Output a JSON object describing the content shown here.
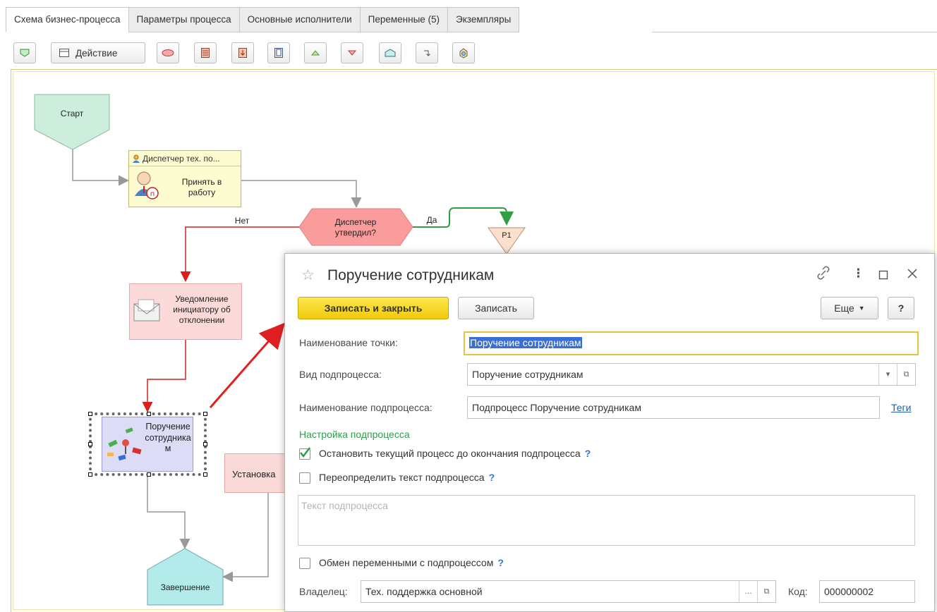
{
  "tabs": [
    {
      "label": "Схема бизнес-процесса",
      "active": true
    },
    {
      "label": "Параметры процесса",
      "active": false
    },
    {
      "label": "Основные исполнители",
      "active": false
    },
    {
      "label": "Переменные (5)",
      "active": false
    },
    {
      "label": "Экземпляры",
      "active": false
    }
  ],
  "toolbar": {
    "action_label": "Действие",
    "tools": [
      "start-point-icon",
      "action-icon",
      "ellipse-icon",
      "task-list-icon",
      "import-icon",
      "frame-icon",
      "arrow-up-icon",
      "arrow-down-icon",
      "end-point-icon",
      "connector-icon",
      "subprocess-icon"
    ]
  },
  "diagram": {
    "start": "Старт",
    "task_performer": "Диспетчер тех. по...",
    "task_name": "Принять в работу",
    "condition": "Диспетчер утвердил?",
    "branch_no": "Нет",
    "branch_yes": "Да",
    "split_label": "Р1",
    "notify": "Уведомление инициатору об отклонении",
    "subprocess": "Поручение сотрудникам",
    "install": "Установка",
    "finish": "Завершение",
    "colors": {
      "start": "#cdeedd",
      "condition": "#fb9c9c",
      "yes_line": "#2f9e44",
      "no_line": "#d91e1e",
      "finish": "#b3ebeb"
    }
  },
  "dialog": {
    "title": "Поручение сотрудникам",
    "controls": [
      "link-icon",
      "more-icon",
      "maximize-icon",
      "close-icon"
    ],
    "buttons": {
      "save_close": "Записать и закрыть",
      "save": "Записать",
      "more": "Еще",
      "help": "?"
    },
    "fields": {
      "point_name_label": "Наименование точки:",
      "point_name_value": "Поручение сотрудникам",
      "subprocess_kind_label": "Вид подпроцесса:",
      "subprocess_kind_value": "Поручение сотрудникам",
      "subprocess_name_label": "Наименование подпроцесса:",
      "subprocess_name_value": "Подпроцесс Поручение сотрудникам",
      "tags_link": "Теги"
    },
    "section_title": "Настройка подпроцесса",
    "checkboxes": {
      "stop_current": {
        "label": "Остановить текущий процесс до окончания подпроцесса",
        "checked": true
      },
      "override_text": {
        "label": "Переопределить текст подпроцесса",
        "checked": false
      },
      "exchange_vars": {
        "label": "Обмен переменными с подпроцессом",
        "checked": false
      }
    },
    "help_mark": "?",
    "text_placeholder": "Текст подпроцесса",
    "owner_label": "Владелец:",
    "owner_value": "Тех. поддержка основной",
    "code_label": "Код:",
    "code_value": "000000002"
  }
}
